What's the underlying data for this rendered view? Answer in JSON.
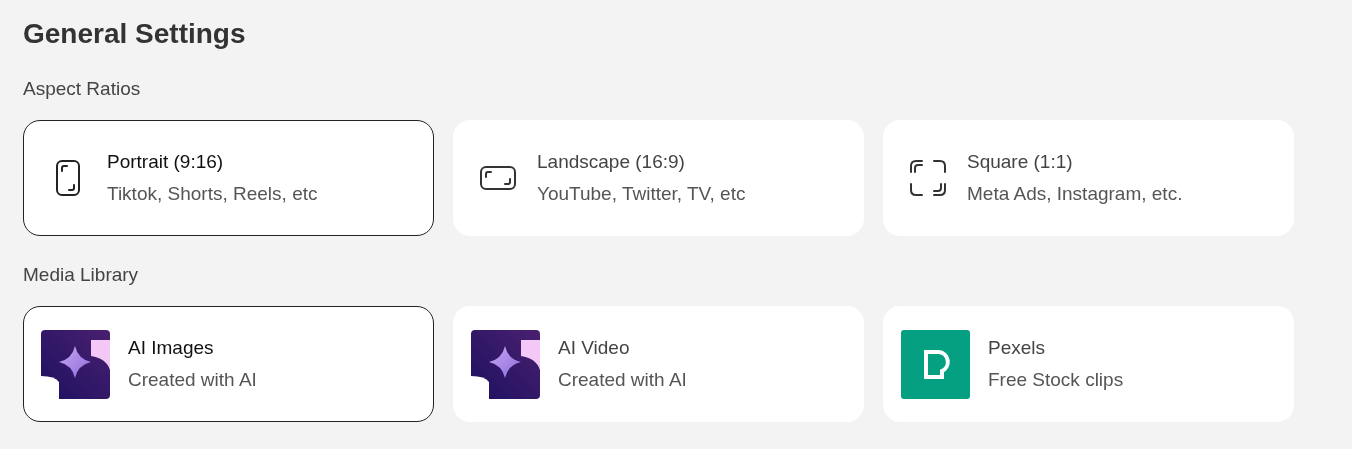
{
  "title": "General Settings",
  "sections": [
    {
      "label": "Aspect Ratios",
      "options": [
        {
          "kind": "portrait",
          "title": "Portrait (9:16)",
          "subtitle": "Tiktok, Shorts, Reels, etc",
          "selected": true
        },
        {
          "kind": "landscape",
          "title": "Landscape (16:9)",
          "subtitle": "YouTube, Twitter, TV, etc",
          "selected": false
        },
        {
          "kind": "square",
          "title": "Square (1:1)",
          "subtitle": "Meta Ads, Instagram, etc.",
          "selected": false
        }
      ]
    },
    {
      "label": "Media Library",
      "options": [
        {
          "kind": "ai",
          "title": "AI Images",
          "subtitle": "Created with AI",
          "selected": true
        },
        {
          "kind": "ai",
          "title": "AI Video",
          "subtitle": "Created with AI",
          "selected": false
        },
        {
          "kind": "pexels",
          "title": "Pexels",
          "subtitle": "Free Stock clips",
          "selected": false
        }
      ]
    }
  ]
}
